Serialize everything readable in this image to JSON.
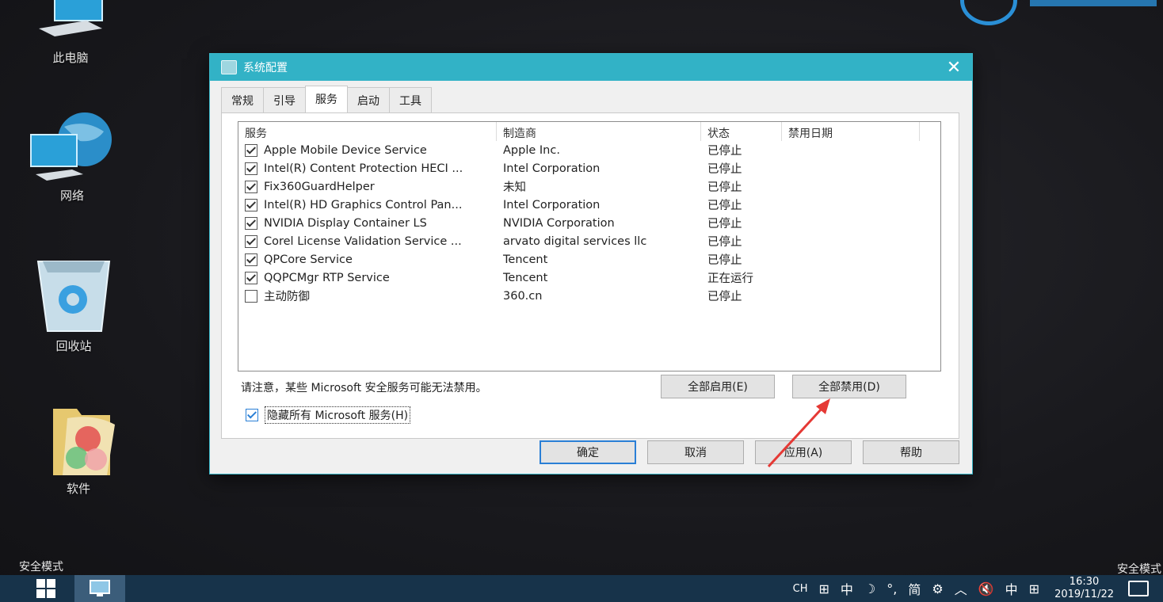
{
  "desktop": {
    "icons": [
      {
        "label": "此电脑",
        "icon": "computer-icon"
      },
      {
        "label": "网络",
        "icon": "network-globe-icon"
      },
      {
        "label": "回收站",
        "icon": "recycle-bin-icon"
      },
      {
        "label": "软件",
        "icon": "folder-icon"
      }
    ],
    "safe_mode_left": "安全模式",
    "safe_mode_right": "安全模式"
  },
  "dialog": {
    "title": "系统配置",
    "close_glyph": "✕",
    "tabs": [
      {
        "label": "常规",
        "active": false
      },
      {
        "label": "引导",
        "active": false
      },
      {
        "label": "服务",
        "active": true
      },
      {
        "label": "启动",
        "active": false
      },
      {
        "label": "工具",
        "active": false
      }
    ],
    "columns": [
      "服务",
      "制造商",
      "状态",
      "禁用日期"
    ],
    "services": [
      {
        "name": "Apple Mobile Device Service",
        "maker": "Apple Inc.",
        "status": "已停止",
        "checked": true
      },
      {
        "name": "Intel(R) Content Protection HECI ...",
        "maker": "Intel Corporation",
        "status": "已停止",
        "checked": true
      },
      {
        "name": "Fix360GuardHelper",
        "maker": "未知",
        "status": "已停止",
        "checked": true
      },
      {
        "name": "Intel(R) HD Graphics Control Pan...",
        "maker": "Intel Corporation",
        "status": "已停止",
        "checked": true
      },
      {
        "name": "NVIDIA Display Container LS",
        "maker": "NVIDIA Corporation",
        "status": "已停止",
        "checked": true
      },
      {
        "name": "Corel License Validation Service ...",
        "maker": "arvato digital services llc",
        "status": "已停止",
        "checked": true
      },
      {
        "name": "QPCore Service",
        "maker": "Tencent",
        "status": "已停止",
        "checked": true
      },
      {
        "name": "QQPCMgr RTP Service",
        "maker": "Tencent",
        "status": "正在运行",
        "checked": true
      },
      {
        "name": "主动防御",
        "maker": "360.cn",
        "status": "已停止",
        "checked": false
      }
    ],
    "note": "请注意，某些 Microsoft 安全服务可能无法禁用。",
    "enable_all": "全部启用(E)",
    "disable_all": "全部禁用(D)",
    "hide_ms_label": "隐藏所有 Microsoft 服务(H)",
    "hide_ms_checked": true,
    "ok": "确定",
    "cancel": "取消",
    "apply": "应用(A)",
    "help": "帮助"
  },
  "taskbar": {
    "tray": [
      "CH",
      "⊞",
      "中",
      "☽",
      "°,",
      "简",
      "⚙",
      "︿",
      "🔇",
      "中",
      "⊞"
    ],
    "time": "16:30",
    "date": "2019/11/22"
  },
  "colors": {
    "titlebar": "#32b2c6",
    "taskbar": "#17334a",
    "arrow": "#e53935"
  }
}
